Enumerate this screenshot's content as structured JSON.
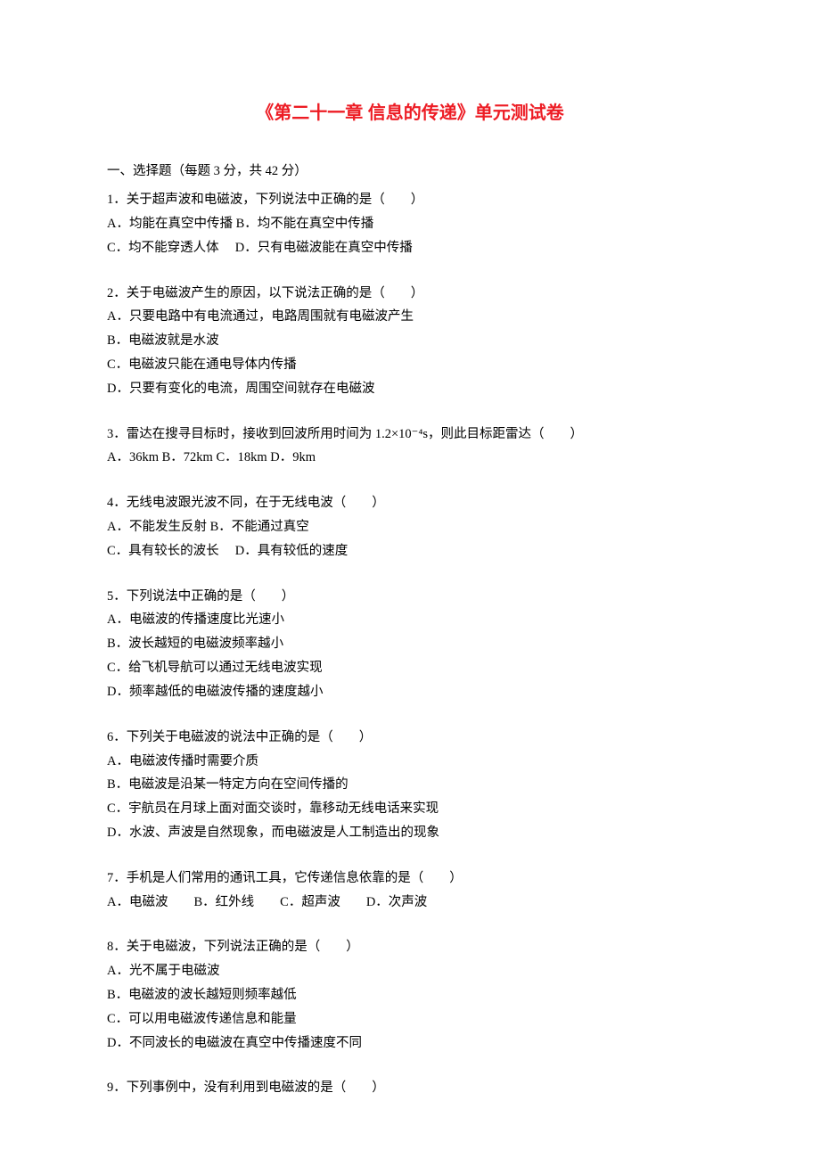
{
  "title": "《第二十一章 信息的传递》单元测试卷",
  "section_header": "一、选择题（每题 3 分，共 42 分）",
  "questions": [
    {
      "stem": "1．关于超声波和电磁波，下列说法中正确的是（　　）",
      "options": [
        "A．均能在真空中传播 B．均不能在真空中传播",
        "C．均不能穿透人体　 D．只有电磁波能在真空中传播"
      ]
    },
    {
      "stem": "2．关于电磁波产生的原因，以下说法正确的是（　　）",
      "options": [
        "A．只要电路中有电流通过，电路周围就有电磁波产生",
        "B．电磁波就是水波",
        "C．电磁波只能在通电导体内传播",
        "D．只要有变化的电流，周围空间就存在电磁波"
      ]
    },
    {
      "stem": "3．雷达在搜寻目标时，接收到回波所用时间为 1.2×10⁻⁴s，则此目标距雷达（　　）",
      "options": [
        "A．36km B．72km C．18km D．9km"
      ]
    },
    {
      "stem": "4．无线电波跟光波不同，在于无线电波（　　）",
      "options": [
        "A．不能发生反射 B．不能通过真空",
        "C．具有较长的波长　 D．具有较低的速度"
      ]
    },
    {
      "stem": "5．下列说法中正确的是（　　）",
      "options": [
        "A．电磁波的传播速度比光速小",
        "B．波长越短的电磁波频率越小",
        "C．给飞机导航可以通过无线电波实现",
        "D．频率越低的电磁波传播的速度越小"
      ]
    },
    {
      "stem": "6．下列关于电磁波的说法中正确的是（　　）",
      "options": [
        "A．电磁波传播时需要介质",
        "B．电磁波是沿某一特定方向在空间传播的",
        "C．宇航员在月球上面对面交谈时，靠移动无线电话来实现",
        "D．水波、声波是自然现象，而电磁波是人工制造出的现象"
      ]
    },
    {
      "stem": "7．手机是人们常用的通讯工具，它传递信息依靠的是（　　）",
      "options": [
        "A．电磁波　　B．红外线　　C．超声波　　D．次声波"
      ]
    },
    {
      "stem": "8．关于电磁波，下列说法正确的是（　　）",
      "options": [
        "A．光不属于电磁波",
        "B．电磁波的波长越短则频率越低",
        "C．可以用电磁波传递信息和能量",
        "D．不同波长的电磁波在真空中传播速度不同"
      ]
    },
    {
      "stem": "9．下列事例中，没有利用到电磁波的是（　　）",
      "options": []
    }
  ]
}
